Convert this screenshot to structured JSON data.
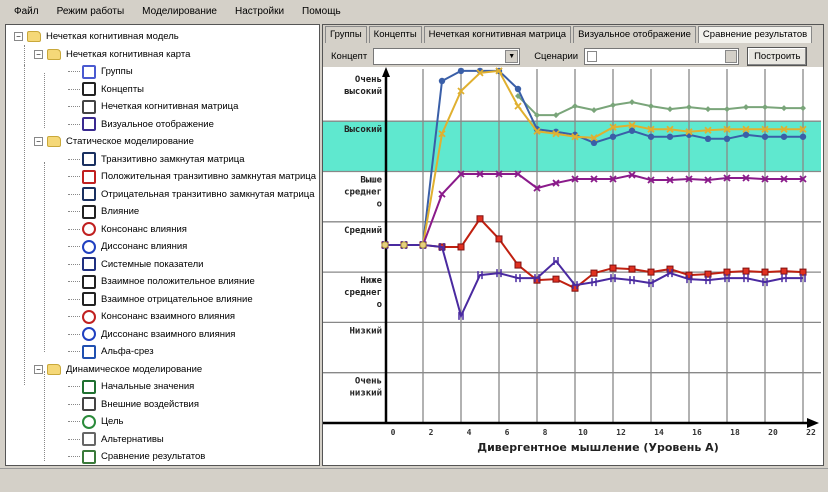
{
  "menu": [
    "Файл",
    "Режим работы",
    "Моделирование",
    "Настройки",
    "Помощь"
  ],
  "tree": [
    {
      "label": "Нечеткая когнитивная модель",
      "level": 0,
      "icon": "folder-icon",
      "exp": true
    },
    {
      "label": "Нечеткая когнитивная карта",
      "level": 1,
      "icon": "folder-icon",
      "exp": true
    },
    {
      "label": "Группы",
      "level": 2,
      "icon": "groups-icon"
    },
    {
      "label": "Концепты",
      "level": 2,
      "icon": "list-icon"
    },
    {
      "label": "Нечеткая когнитивная матрица",
      "level": 2,
      "icon": "matrix-icon"
    },
    {
      "label": "Визуальное отображение",
      "level": 2,
      "icon": "visual-icon"
    },
    {
      "label": "Статическое моделирование",
      "level": 1,
      "icon": "folder-icon",
      "exp": true
    },
    {
      "label": "Транзитивно замкнутая матрица",
      "level": 2,
      "icon": "bracket-matrix-icon"
    },
    {
      "label": "Положительная транзитивно замкнутая матрица",
      "level": 2,
      "icon": "plus-matrix-icon"
    },
    {
      "label": "Отрицательная транзитивно замкнутая матрица",
      "level": 2,
      "icon": "minus-matrix-icon"
    },
    {
      "label": "Влияние",
      "level": 2,
      "icon": "influence-icon"
    },
    {
      "label": "Консонанс влияния",
      "level": 2,
      "icon": "consonance-icon"
    },
    {
      "label": "Диссонанс влияния",
      "level": 2,
      "icon": "dissonance-icon"
    },
    {
      "label": "Системные показатели",
      "level": 2,
      "icon": "system-indicators-icon"
    },
    {
      "label": "Взаимное положительное влияние",
      "level": 2,
      "icon": "influence-icon"
    },
    {
      "label": "Взаимное отрицательное влияние",
      "level": 2,
      "icon": "influence-icon"
    },
    {
      "label": "Консонанс взаимного влияния",
      "level": 2,
      "icon": "consonance-icon"
    },
    {
      "label": "Диссонанс взаимного влияния",
      "level": 2,
      "icon": "dissonance-icon"
    },
    {
      "label": "Альфа-срез",
      "level": 2,
      "icon": "alpha-cut-icon"
    },
    {
      "label": "Динамическое моделирование",
      "level": 1,
      "icon": "folder-icon",
      "exp": true
    },
    {
      "label": "Начальные значения",
      "level": 2,
      "icon": "initial-values-icon"
    },
    {
      "label": "Внешние воздействия",
      "level": 2,
      "icon": "external-impact-icon"
    },
    {
      "label": "Цель",
      "level": 2,
      "icon": "target-icon"
    },
    {
      "label": "Альтернативы",
      "level": 2,
      "icon": "alternatives-icon"
    },
    {
      "label": "Сравнение результатов",
      "level": 2,
      "icon": "compare-results-icon"
    }
  ],
  "tabs": [
    {
      "label": "Группы"
    },
    {
      "label": "Концепты"
    },
    {
      "label": "Нечеткая когнитивная матрица"
    },
    {
      "label": "Визуальное отображение"
    },
    {
      "label": "Сравнение результатов",
      "active": true
    }
  ],
  "toolbar": {
    "concept_label": "Концепт",
    "concept_value": "",
    "scenarios_label": "Сценарии",
    "scenarios_value": "",
    "build_button": "Построить"
  },
  "chart_data": {
    "type": "line",
    "xlabel": "Дивергентное мышление (Уровень А)",
    "x": [
      0,
      1,
      2,
      3,
      4,
      5,
      6,
      7,
      8,
      9,
      10,
      11,
      12,
      13,
      14,
      15,
      16,
      17,
      18,
      19,
      20,
      21,
      22
    ],
    "xticks": [
      0,
      2,
      4,
      6,
      8,
      10,
      12,
      14,
      16,
      18,
      20,
      22
    ],
    "ylim": [
      0,
      7
    ],
    "ylevels": [
      "Очень низкий",
      "Низкий",
      "Ниже среднего",
      "Средний",
      "Выше среднего",
      "Высокий",
      "Очень высокий"
    ],
    "highlight_level": "Высокий",
    "highlight_color": "#5fe8cf",
    "series": [
      {
        "name": "series-green",
        "color": "#7aa57a",
        "marker": "diamond",
        "values": [
          null,
          null,
          null,
          null,
          null,
          null,
          null,
          6.5,
          6.12,
          6.12,
          6.3,
          6.22,
          6.32,
          6.38,
          6.3,
          6.24,
          6.28,
          6.24,
          6.24,
          6.28,
          6.28,
          6.26,
          6.26
        ]
      },
      {
        "name": "series-blue",
        "color": "#3a5fa8",
        "marker": "circle",
        "values": [
          3.54,
          3.54,
          3.54,
          6.8,
          7.0,
          7.0,
          7.0,
          6.64,
          5.84,
          5.79,
          5.73,
          5.57,
          5.69,
          5.81,
          5.69,
          5.69,
          5.73,
          5.65,
          5.65,
          5.73,
          5.69,
          5.69,
          5.69
        ]
      },
      {
        "name": "series-yellow",
        "color": "#e0b030",
        "marker": "x",
        "values": [
          3.54,
          3.54,
          3.54,
          5.75,
          6.6,
          6.96,
          7.0,
          6.3,
          5.8,
          5.75,
          5.69,
          5.67,
          5.88,
          5.92,
          5.84,
          5.84,
          5.79,
          5.82,
          5.84,
          5.84,
          5.84,
          5.84,
          5.84
        ]
      },
      {
        "name": "series-magenta",
        "color": "#8a1a8a",
        "marker": "x",
        "values": [
          3.54,
          3.54,
          3.54,
          4.55,
          4.95,
          4.95,
          4.95,
          4.95,
          4.67,
          4.77,
          4.85,
          4.85,
          4.85,
          4.93,
          4.83,
          4.83,
          4.85,
          4.83,
          4.87,
          4.87,
          4.85,
          4.85,
          4.85
        ]
      },
      {
        "name": "series-red",
        "color": "#c02010",
        "marker": "square",
        "values": [
          3.54,
          3.54,
          3.54,
          3.5,
          3.5,
          4.06,
          3.66,
          3.14,
          2.84,
          2.86,
          2.68,
          2.98,
          3.08,
          3.06,
          3.0,
          3.06,
          2.94,
          2.96,
          3.0,
          3.02,
          3.0,
          3.02,
          3.0
        ]
      },
      {
        "name": "series-indigo",
        "color": "#4a2aa0",
        "marker": "bar",
        "values": [
          3.54,
          3.54,
          3.54,
          3.5,
          2.13,
          2.94,
          2.98,
          2.88,
          2.88,
          3.22,
          2.74,
          2.8,
          2.88,
          2.84,
          2.78,
          2.98,
          2.86,
          2.84,
          2.88,
          2.88,
          2.8,
          2.88,
          2.88
        ]
      }
    ]
  }
}
